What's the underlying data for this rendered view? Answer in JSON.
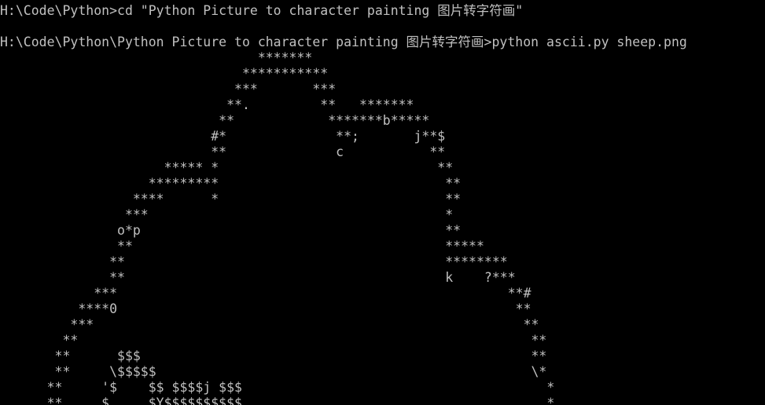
{
  "colors": {
    "background": "#000000",
    "text": "#c0c0c0"
  },
  "console": {
    "lines": [
      "H:\\Code\\Python>cd \"Python Picture to character painting 图片转字符画\"",
      "",
      "H:\\Code\\Python\\Python Picture to character painting 图片转字符画>python ascii.py sheep.png",
      "                                 *******",
      "                               ***********",
      "                              ***       ***",
      "                             **.         **   *******",
      "                            **            *******b*****",
      "                           #*              **;       j**$",
      "                           **              c           **",
      "                     ***** *                            **",
      "                   *********                             **",
      "                 ****      *                             **",
      "                ***                                      *",
      "               o*p                                       **",
      "               **                                        *****",
      "              **                                         ********",
      "              **                                         k    ?***",
      "            ***                                                  **#",
      "          ****0                                                   **",
      "         ***                                                       **",
      "        **                                                          **",
      "       **      $$$                                                  **",
      "       **     \\$$$$$                                                \\*",
      "      **     '$    $$ $$$$j $$$                                       *",
      "      **     $     $Y$$$$$$$$$$                                       *"
    ]
  }
}
